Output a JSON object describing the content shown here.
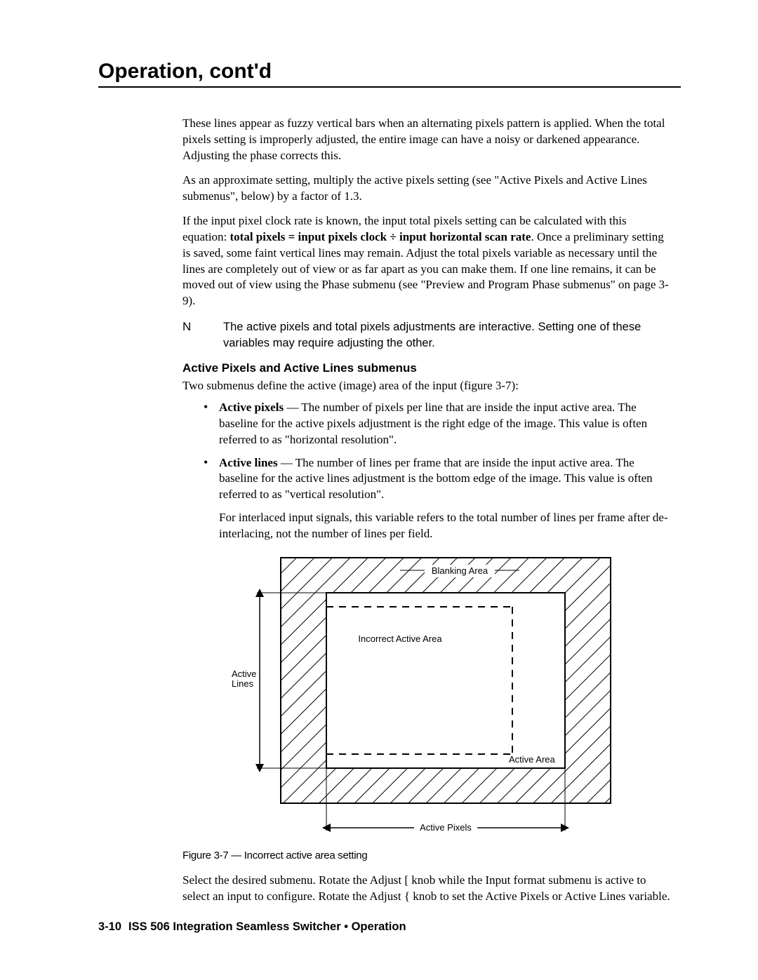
{
  "header": "Operation, cont'd",
  "p1": "These lines appear as fuzzy vertical bars when an alternating pixels pattern is applied.  When the total pixels setting is improperly adjusted, the entire image can have a noisy or darkened appearance.  Adjusting the phase corrects this.",
  "p2": "As an approximate setting, multiply the active pixels setting (see \"Active Pixels and Active Lines submenus\", below) by a factor of 1.3.",
  "p3a": "If the input pixel clock rate is known, the input total pixels setting can be calculated with this equation: ",
  "equation": "total pixels = input pixels clock ÷ input horizontal scan rate",
  "p3b": ".  Once a preliminary setting is saved, some faint vertical lines may remain.  Adjust the total pixels variable as necessary until the lines are completely out of view or as far apart as you can make them.  If one line remains, it can be moved out of view using the Phase submenu (see \"Preview and Program Phase submenus\" on page 3-9).",
  "note_n": "N",
  "note_text": "The active pixels and total pixels adjustments are interactive.  Setting one of these variables may require adjusting the other.",
  "subheading": "Active Pixels and Active Lines submenus",
  "p4": "Two submenus define the active (image) area of the input (figure 3-7):",
  "b1_lead": "Active pixels",
  "b1_dash": " — ",
  "b1_body": "The number of pixels per line that are inside the input active area.  The baseline for the active pixels adjustment is the right edge of the image.  This value is often referred to as \"horizontal resolution\".",
  "b2_lead": "Active lines",
  "b2_dash": " — ",
  "b2_body": "The number of lines per frame that are inside the input active area.  The baseline for the active lines adjustment is the bottom edge of the image.  This value is often referred to as \"vertical resolution\".",
  "b2_extra": "For interlaced input signals, this variable refers to the total number of lines per frame after de-interlacing, not the number of lines per field.",
  "fig": {
    "label_blanking": "Blanking Area",
    "label_incorrect": "Incorrect Active Area",
    "label_active_lines": "Active\nLines",
    "label_active_area": "Active Area",
    "label_active_pixels": "Active Pixels",
    "caption": "Figure 3-7 — Incorrect active area setting"
  },
  "p5": "Select the desired submenu.  Rotate the Adjust [ knob while the Input format submenu is active to select an input to configure.  Rotate the Adjust { knob to set the Active Pixels or Active Lines variable.",
  "footer_page": "3-10",
  "footer_text": "ISS 506 Integration Seamless Switcher • Operation"
}
